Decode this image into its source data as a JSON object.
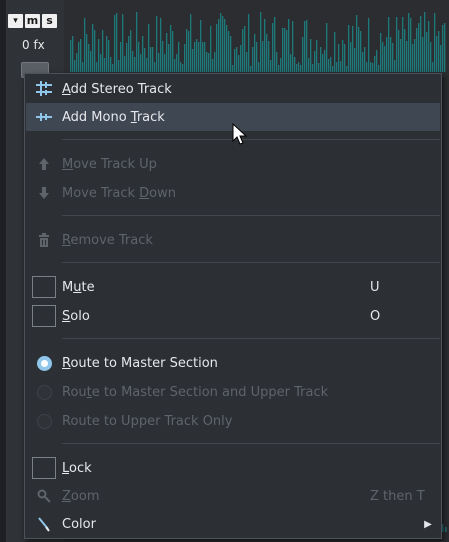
{
  "track": {
    "arrow_label": "▾",
    "mute_label": "m",
    "solo_label": "s",
    "fx_label": "0 fx"
  },
  "menu": {
    "items": [
      {
        "label": "Add Stereo Track",
        "shortcut": "",
        "icon": "stereo-track-icon",
        "enabled": true
      },
      {
        "label": "Add Mono Track",
        "shortcut": "",
        "icon": "mono-track-icon",
        "enabled": true,
        "hovered": true
      },
      {
        "label": "Move Track Up",
        "shortcut": "",
        "icon": "arrow-up-icon",
        "enabled": false
      },
      {
        "label": "Move Track Down",
        "shortcut": "",
        "icon": "arrow-down-icon",
        "enabled": false
      },
      {
        "label": "Remove Track",
        "shortcut": "",
        "icon": "trash-icon",
        "enabled": false
      },
      {
        "label": "Mute",
        "shortcut": "U",
        "icon": "checkbox",
        "enabled": true,
        "checked": false
      },
      {
        "label": "Solo",
        "shortcut": "O",
        "icon": "checkbox",
        "enabled": true,
        "checked": false
      },
      {
        "label": "Route to Master Section",
        "shortcut": "",
        "icon": "radio",
        "enabled": true,
        "selected": true
      },
      {
        "label": "Route to Master Section and Upper Track",
        "shortcut": "",
        "icon": "radio",
        "enabled": false,
        "selected": false
      },
      {
        "label": "Route to Upper Track Only",
        "shortcut": "",
        "icon": "radio",
        "enabled": false,
        "selected": false
      },
      {
        "label": "Lock",
        "shortcut": "",
        "icon": "checkbox",
        "enabled": true,
        "checked": false
      },
      {
        "label": "Zoom",
        "shortcut": "Z then T",
        "icon": "zoom-icon",
        "enabled": false
      },
      {
        "label": "Color",
        "shortcut": "",
        "icon": "color-pen-icon",
        "enabled": true,
        "has_submenu": true
      }
    ]
  },
  "colors": {
    "menu_bg": "#2c2f34",
    "hover_bg": "#3f4753",
    "accent": "#8fc6ea",
    "waveform": "#1e7a7a",
    "disabled_text": "#5f646b"
  }
}
